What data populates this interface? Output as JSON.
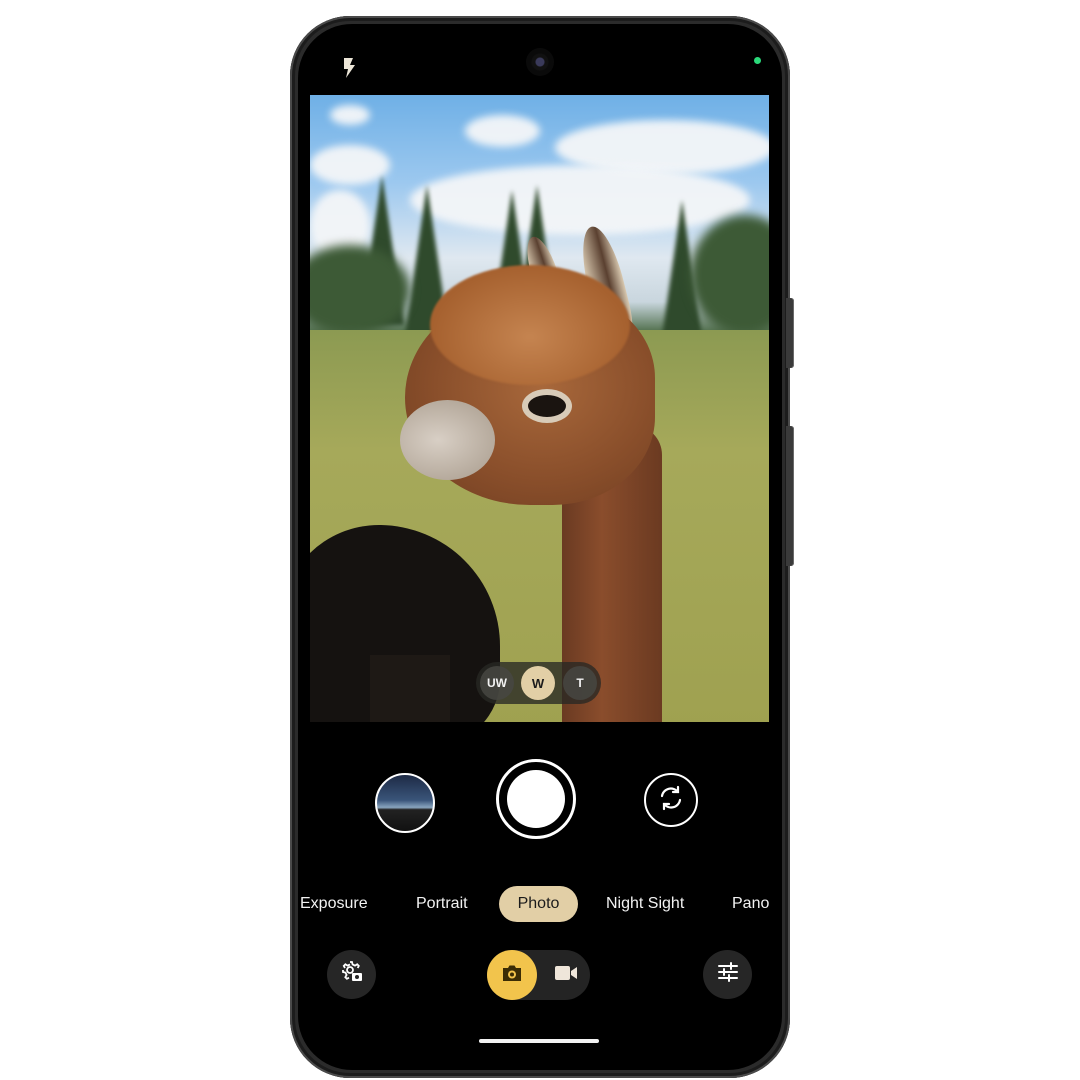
{
  "app": "Camera",
  "status_bar": {
    "flash_icon": "flash-auto-icon",
    "privacy_indicator_color": "#2bd97a"
  },
  "viewfinder": {
    "subject": "alpaca in a grassy field"
  },
  "lens_switcher": {
    "options": [
      {
        "label": "UW",
        "selected": false
      },
      {
        "label": "W",
        "selected": true
      },
      {
        "label": "T",
        "selected": false
      }
    ]
  },
  "controls": {
    "gallery_icon": "gallery-thumbnail",
    "shutter_icon": "shutter-button",
    "flip_icon": "flip-camera-icon"
  },
  "modes": {
    "items": [
      "Exposure",
      "Portrait",
      "Photo",
      "Night Sight",
      "Pano"
    ],
    "selected": "Photo"
  },
  "bottom_bar": {
    "settings_icon": "camera-settings-icon",
    "photo_mode_icon": "camera-icon",
    "video_mode_icon": "video-icon",
    "adjust_icon": "sliders-icon",
    "active_mode": "photo"
  },
  "colors": {
    "accent_selected": "#e2cfa6",
    "photo_toggle": "#f2c44c"
  }
}
